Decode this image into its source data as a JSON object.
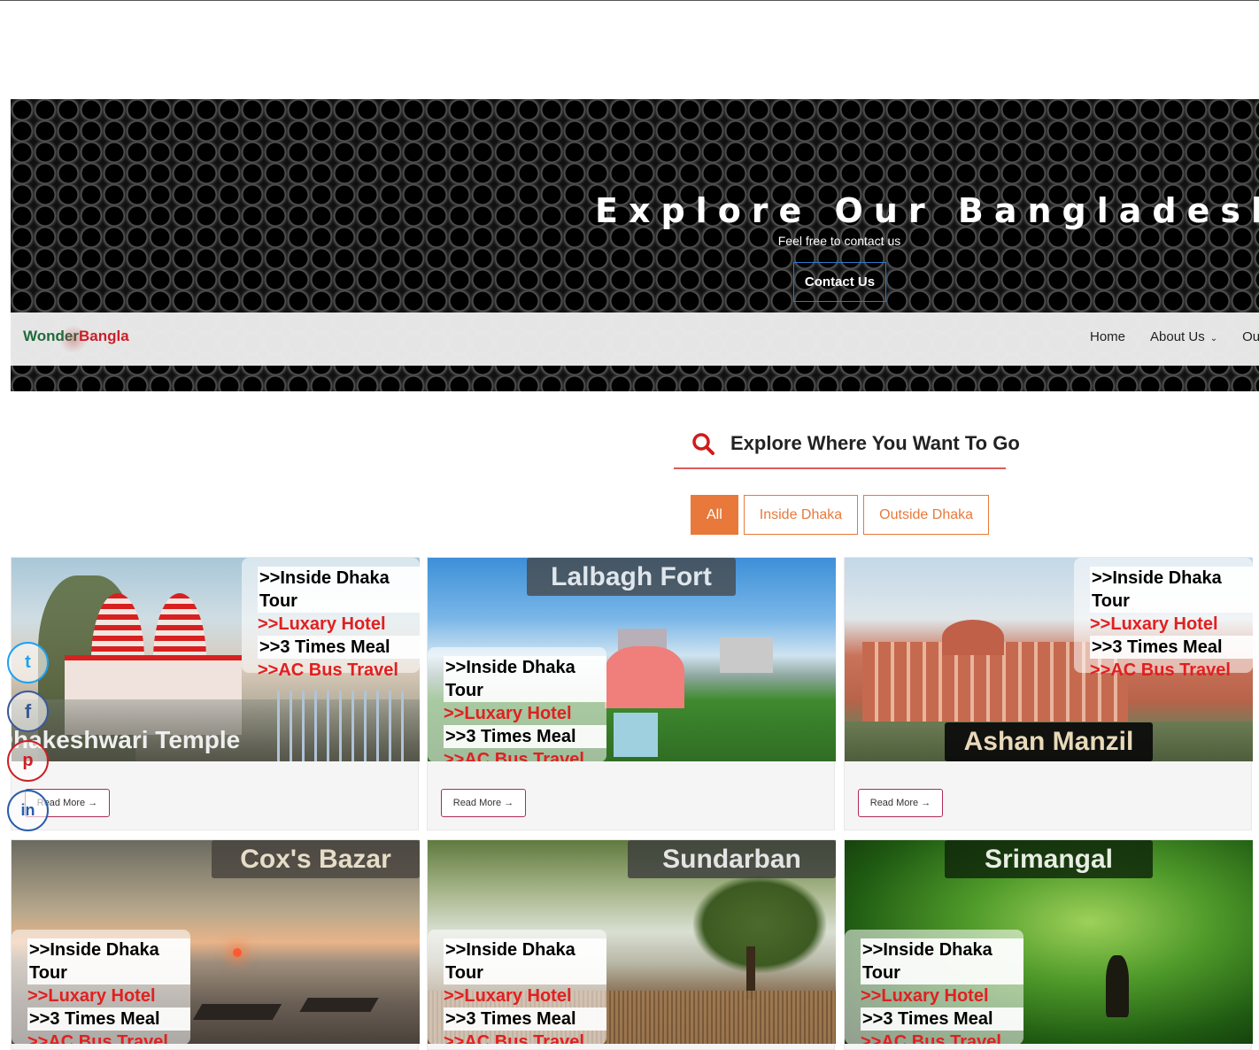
{
  "hero": {
    "title": "Explore Our Bangladesh",
    "subtitle": "Feel free to contact us",
    "button_label": "Contact Us"
  },
  "nav": {
    "logo_part1": "Wonder",
    "logo_part2": "Bangla",
    "items": [
      {
        "label": "Home"
      },
      {
        "label": "About Us"
      },
      {
        "label": "Our T"
      }
    ]
  },
  "explore": {
    "title": "Explore Where You Want To Go"
  },
  "filters": [
    {
      "label": "All",
      "active": true
    },
    {
      "label": "Inside Dhaka",
      "active": false
    },
    {
      "label": "Outside Dhaka",
      "active": false
    }
  ],
  "promo_lines": [
    ">>Inside Dhaka Tour",
    ">>Luxary Hotel",
    ">>3 Times Meal",
    ">>AC Bus Travel"
  ],
  "cards": [
    {
      "caption": "Dhakeshwari Temple",
      "read_more": "Read More →"
    },
    {
      "caption": "Lalbagh Fort",
      "read_more": "Read More →"
    },
    {
      "caption": "Ashan Manzil",
      "read_more": "Read More →"
    },
    {
      "caption": "Cox's Bazar"
    },
    {
      "caption": "Sundarban"
    },
    {
      "caption": "Srimangal"
    }
  ],
  "social": [
    {
      "icon": "twitter-icon",
      "glyph": "t",
      "color": "#1da1f2"
    },
    {
      "icon": "facebook-icon",
      "glyph": "f",
      "color": "#3b5998"
    },
    {
      "icon": "pinterest-icon",
      "glyph": "p",
      "color": "#cb2027"
    },
    {
      "icon": "linkedin-icon",
      "glyph": "in",
      "color": "#2a5caa"
    }
  ],
  "colors": {
    "accent_orange": "#e8793a",
    "promo_red": "#e02020",
    "underline_red": "#e05a5a",
    "contact_border": "#2e79c9"
  }
}
